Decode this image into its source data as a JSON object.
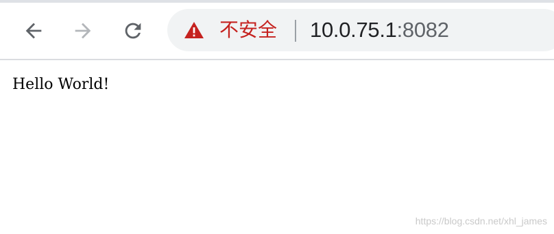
{
  "address_bar": {
    "security_label": "不安全",
    "url_host": "10.0.75.1",
    "url_port": ":8082"
  },
  "page": {
    "body_text": "Hello World!"
  },
  "watermark": "https://blog.csdn.net/xhl_james",
  "colors": {
    "warning_red": "#c5221f",
    "toolbar_icon": "#5f6368",
    "disabled_icon": "#b3b6ba",
    "omnibox_bg": "#f1f3f4"
  },
  "icons": {
    "back": "back-arrow-icon",
    "forward": "forward-arrow-icon",
    "reload": "reload-icon",
    "security": "warning-triangle-icon"
  }
}
